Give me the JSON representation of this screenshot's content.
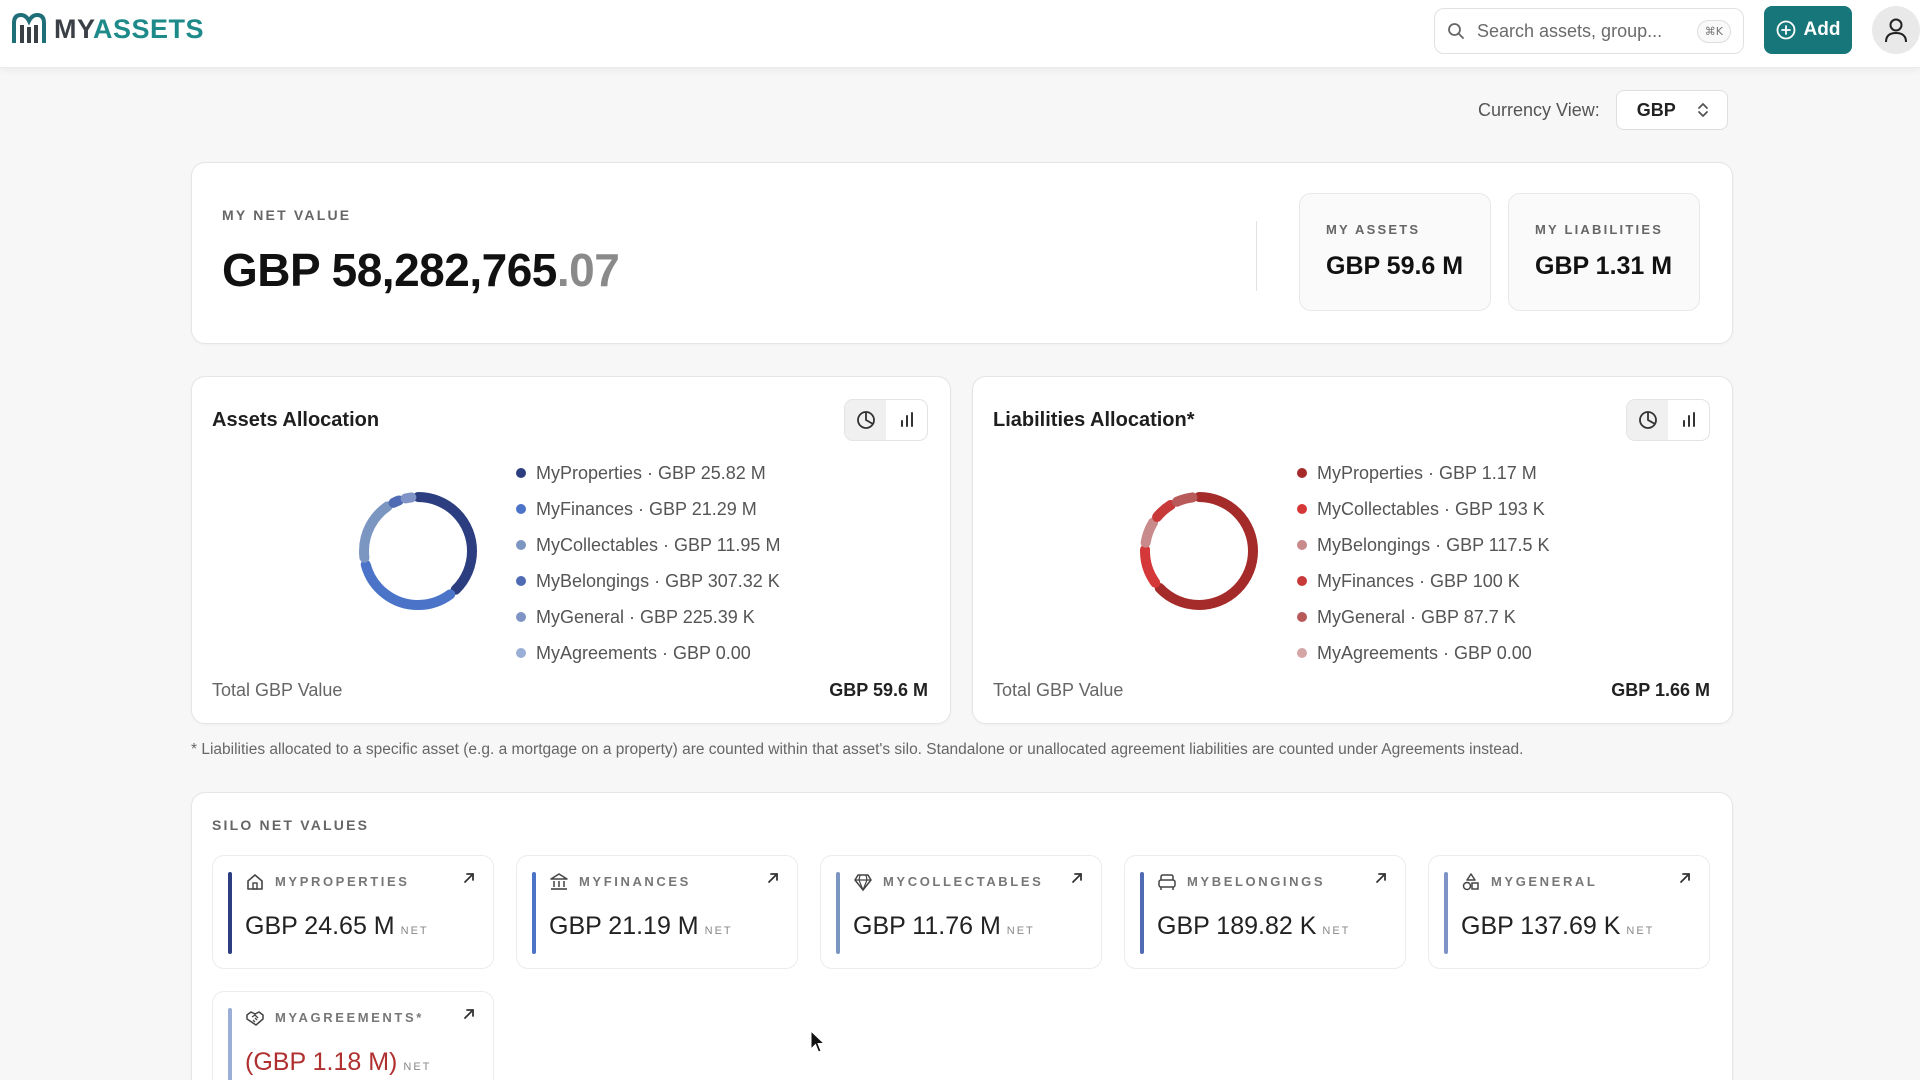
{
  "header": {
    "logo_prefix": "MY",
    "logo_suffix": "ASSETS",
    "search_placeholder": "Search assets, group...",
    "search_shortcut": "⌘K",
    "add_label": "Add"
  },
  "currency": {
    "label": "Currency View:",
    "value": "GBP"
  },
  "net": {
    "label": "MY NET VALUE",
    "value_main": "GBP 58,282,765",
    "value_decimal": ".07",
    "assets_label": "MY ASSETS",
    "assets_value": "GBP 59.6 M",
    "liabilities_label": "MY LIABILITIES",
    "liabilities_value": "GBP 1.31 M"
  },
  "assets_allocation": {
    "title": "Assets Allocation",
    "items": [
      {
        "name": "MyProperties",
        "value": "GBP 25.82 M",
        "amount": 25.82,
        "color": "#2c3e7f"
      },
      {
        "name": "MyFinances",
        "value": "GBP 21.29 M",
        "amount": 21.29,
        "color": "#4b74c9"
      },
      {
        "name": "MyCollectables",
        "value": "GBP 11.95 M",
        "amount": 11.95,
        "color": "#7c96c2"
      },
      {
        "name": "MyBelongings",
        "value": "GBP 307.32 K",
        "amount": 0.30732,
        "color": "#4e6bb3"
      },
      {
        "name": "MyGeneral",
        "value": "GBP 225.39 K",
        "amount": 0.22539,
        "color": "#7f93c6"
      },
      {
        "name": "MyAgreements",
        "value": "GBP 0.00",
        "amount": 0,
        "color": "#9aaed6"
      }
    ],
    "total_label": "Total GBP Value",
    "total_value": "GBP 59.6 M"
  },
  "liabilities_allocation": {
    "title": "Liabilities Allocation*",
    "items": [
      {
        "name": "MyProperties",
        "value": "GBP 1.17 M",
        "amount": 1170,
        "color": "#a52b2b"
      },
      {
        "name": "MyCollectables",
        "value": "GBP 193 K",
        "amount": 193,
        "color": "#d43838"
      },
      {
        "name": "MyBelongings",
        "value": "GBP 117.5 K",
        "amount": 117.5,
        "color": "#c88a8a"
      },
      {
        "name": "MyFinances",
        "value": "GBP 100 K",
        "amount": 100,
        "color": "#c83a3a"
      },
      {
        "name": "MyGeneral",
        "value": "GBP 87.7 K",
        "amount": 87.7,
        "color": "#b85a5a"
      },
      {
        "name": "MyAgreements",
        "value": "GBP 0.00",
        "amount": 0,
        "color": "#d4a6a6"
      }
    ],
    "total_label": "Total GBP Value",
    "total_value": "GBP 1.66 M"
  },
  "footnote": "* Liabilities allocated to a specific asset (e.g. a mortgage on a property) are counted within that asset's silo. Standalone or unallocated agreement liabilities are counted under Agreements instead.",
  "silos": {
    "label": "SILO NET VALUES",
    "net_suffix": "NET",
    "items": [
      {
        "name": "MYPROPERTIES",
        "value": "GBP 24.65 M",
        "icon": "home-icon",
        "color": "#2c3e7f"
      },
      {
        "name": "MYFINANCES",
        "value": "GBP 21.19 M",
        "icon": "bank-icon",
        "color": "#4b74c9"
      },
      {
        "name": "MYCOLLECTABLES",
        "value": "GBP 11.76 M",
        "icon": "gem-icon",
        "color": "#7c96c2"
      },
      {
        "name": "MYBELONGINGS",
        "value": "GBP 189.82 K",
        "icon": "sofa-icon",
        "color": "#4e6bb3"
      },
      {
        "name": "MYGENERAL",
        "value": "GBP 137.69 K",
        "icon": "shapes-icon",
        "color": "#7f93c6"
      },
      {
        "name": "MYAGREEMENTS*",
        "value": "(GBP 1.18 M)",
        "icon": "handshake-icon",
        "color": "#9aaed6"
      }
    ]
  }
}
